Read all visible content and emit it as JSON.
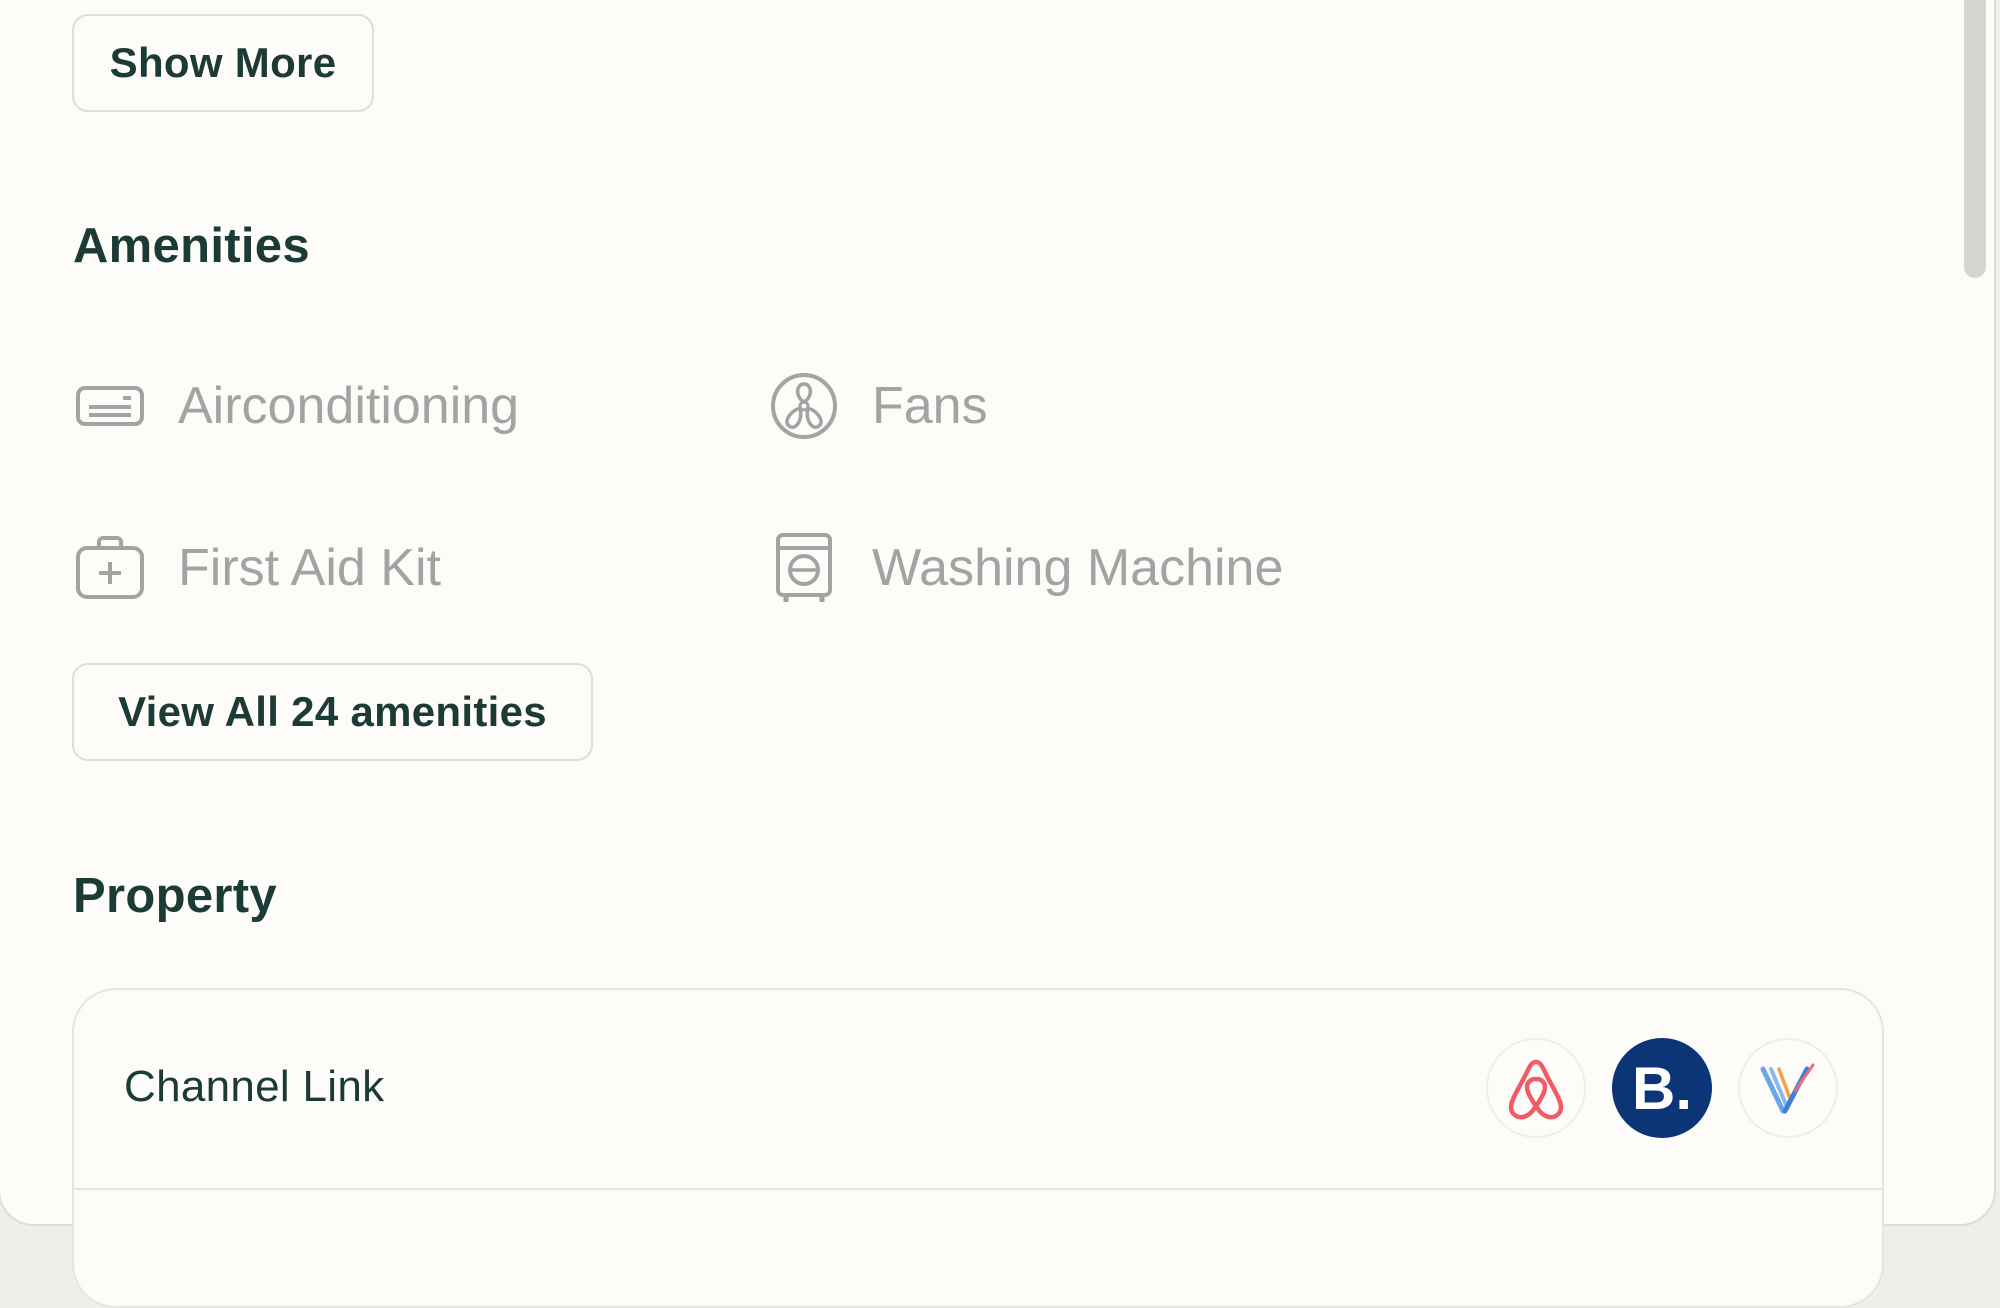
{
  "buttons": {
    "show_more": "Show More",
    "view_all": "View All 24 amenities"
  },
  "amenities": {
    "title": "Amenities",
    "items": [
      {
        "label": "Airconditioning",
        "icon": "air-conditioner-icon"
      },
      {
        "label": "Fans",
        "icon": "fan-icon"
      },
      {
        "label": "First Aid Kit",
        "icon": "first-aid-kit-icon"
      },
      {
        "label": "Washing Machine",
        "icon": "washing-machine-icon"
      }
    ]
  },
  "property": {
    "title": "Property",
    "channel_link_label": "Channel Link",
    "channels": [
      {
        "name": "airbnb",
        "icon": "airbnb-icon",
        "color": "#f05b66"
      },
      {
        "name": "booking",
        "icon": "booking-icon",
        "text": "B.",
        "color": "#0c3577"
      },
      {
        "name": "vrbo",
        "icon": "vrbo-icon",
        "color": "#5b9ce6"
      }
    ]
  },
  "colors": {
    "text_dark": "#1c3a36",
    "text_muted": "#a2a3a3",
    "panel_bg": "#fdfcf8"
  }
}
